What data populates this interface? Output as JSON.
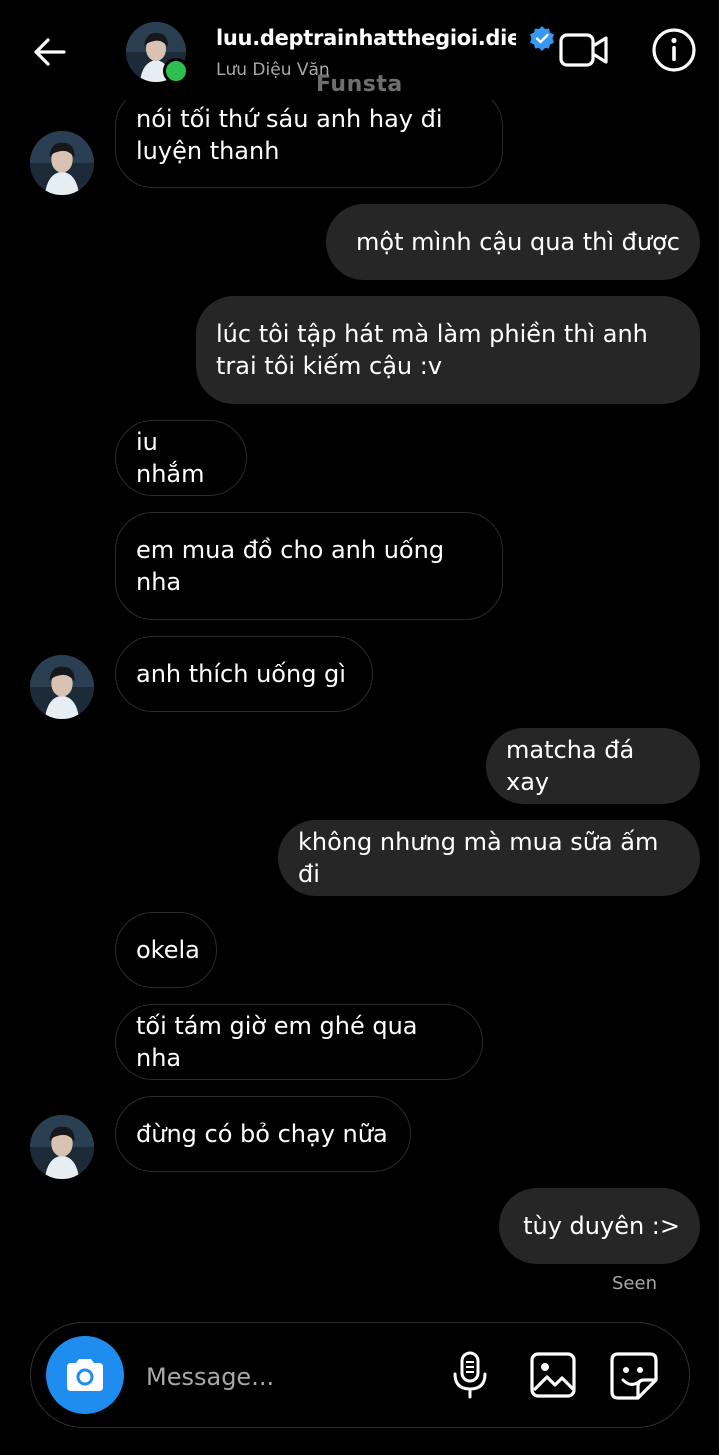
{
  "header": {
    "username": "luu.deptrainhatthegioi.dieu...",
    "full_name": "Lưu Diệu Văn",
    "watermark": "Funsta"
  },
  "messages": [
    {
      "direction": "in",
      "text": "nói tối thứ sáu anh hay đi luyện thanh",
      "avatar": true
    },
    {
      "direction": "out",
      "text": "một mình cậu qua thì được"
    },
    {
      "direction": "out",
      "text": "lúc tôi tập hát mà làm phiền thì anh trai tôi kiếm cậu :v"
    },
    {
      "direction": "in",
      "text": "iu nhắm"
    },
    {
      "direction": "in",
      "text": "em mua đồ cho anh uống nha"
    },
    {
      "direction": "in",
      "text": "anh thích uống gì",
      "avatar": true
    },
    {
      "direction": "out",
      "text": "matcha đá xay"
    },
    {
      "direction": "out",
      "text": "không nhưng mà mua sữa ấm đi"
    },
    {
      "direction": "in",
      "text": "okela"
    },
    {
      "direction": "in",
      "text": "tối tám giờ em ghé qua nha"
    },
    {
      "direction": "in",
      "text": "đừng có bỏ chạy nữa",
      "avatar": true
    },
    {
      "direction": "out",
      "text": "tùy duyên :>"
    }
  ],
  "seen_label": "Seen",
  "composer": {
    "placeholder": "Message..."
  },
  "icons": {
    "back": "back-arrow-icon",
    "verified": "verified-badge-icon",
    "video": "video-call-icon",
    "info": "info-icon",
    "camera": "camera-icon",
    "mic": "microphone-icon",
    "image": "gallery-icon",
    "sticker": "sticker-icon"
  },
  "colors": {
    "background": "#000000",
    "outgoing_bubble": "#262626",
    "incoming_border": "#2a2a2a",
    "accent_blue": "#1f8cf0",
    "online_green": "#2ec04f",
    "muted_text": "#a8a8a8"
  }
}
